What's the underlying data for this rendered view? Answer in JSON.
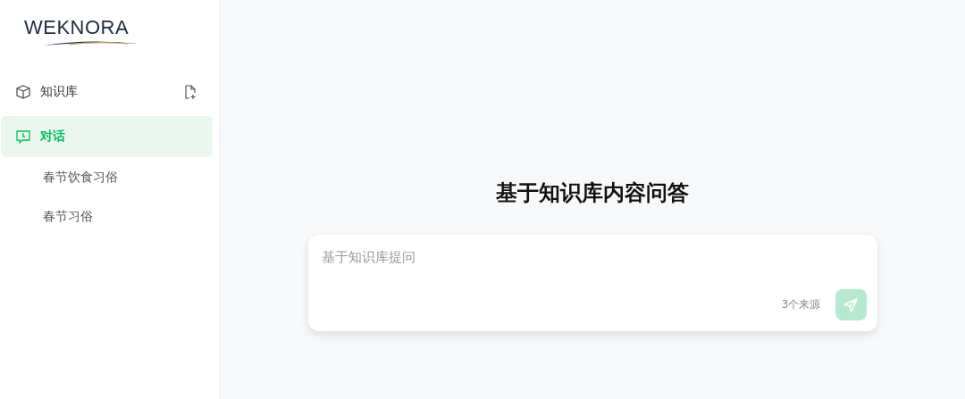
{
  "sidebar": {
    "logo": "WEKNORA",
    "nav": [
      {
        "label": "知识库",
        "selected": false
      },
      {
        "label": "对话",
        "selected": true
      }
    ],
    "conversations": [
      {
        "label": "春节饮食习俗"
      },
      {
        "label": "春节习俗"
      }
    ]
  },
  "main": {
    "heading": "基于知识库内容问答",
    "input": {
      "placeholder": "基于知识库提问"
    },
    "sources": "3个来源",
    "send": {
      "disabled": true
    }
  }
}
